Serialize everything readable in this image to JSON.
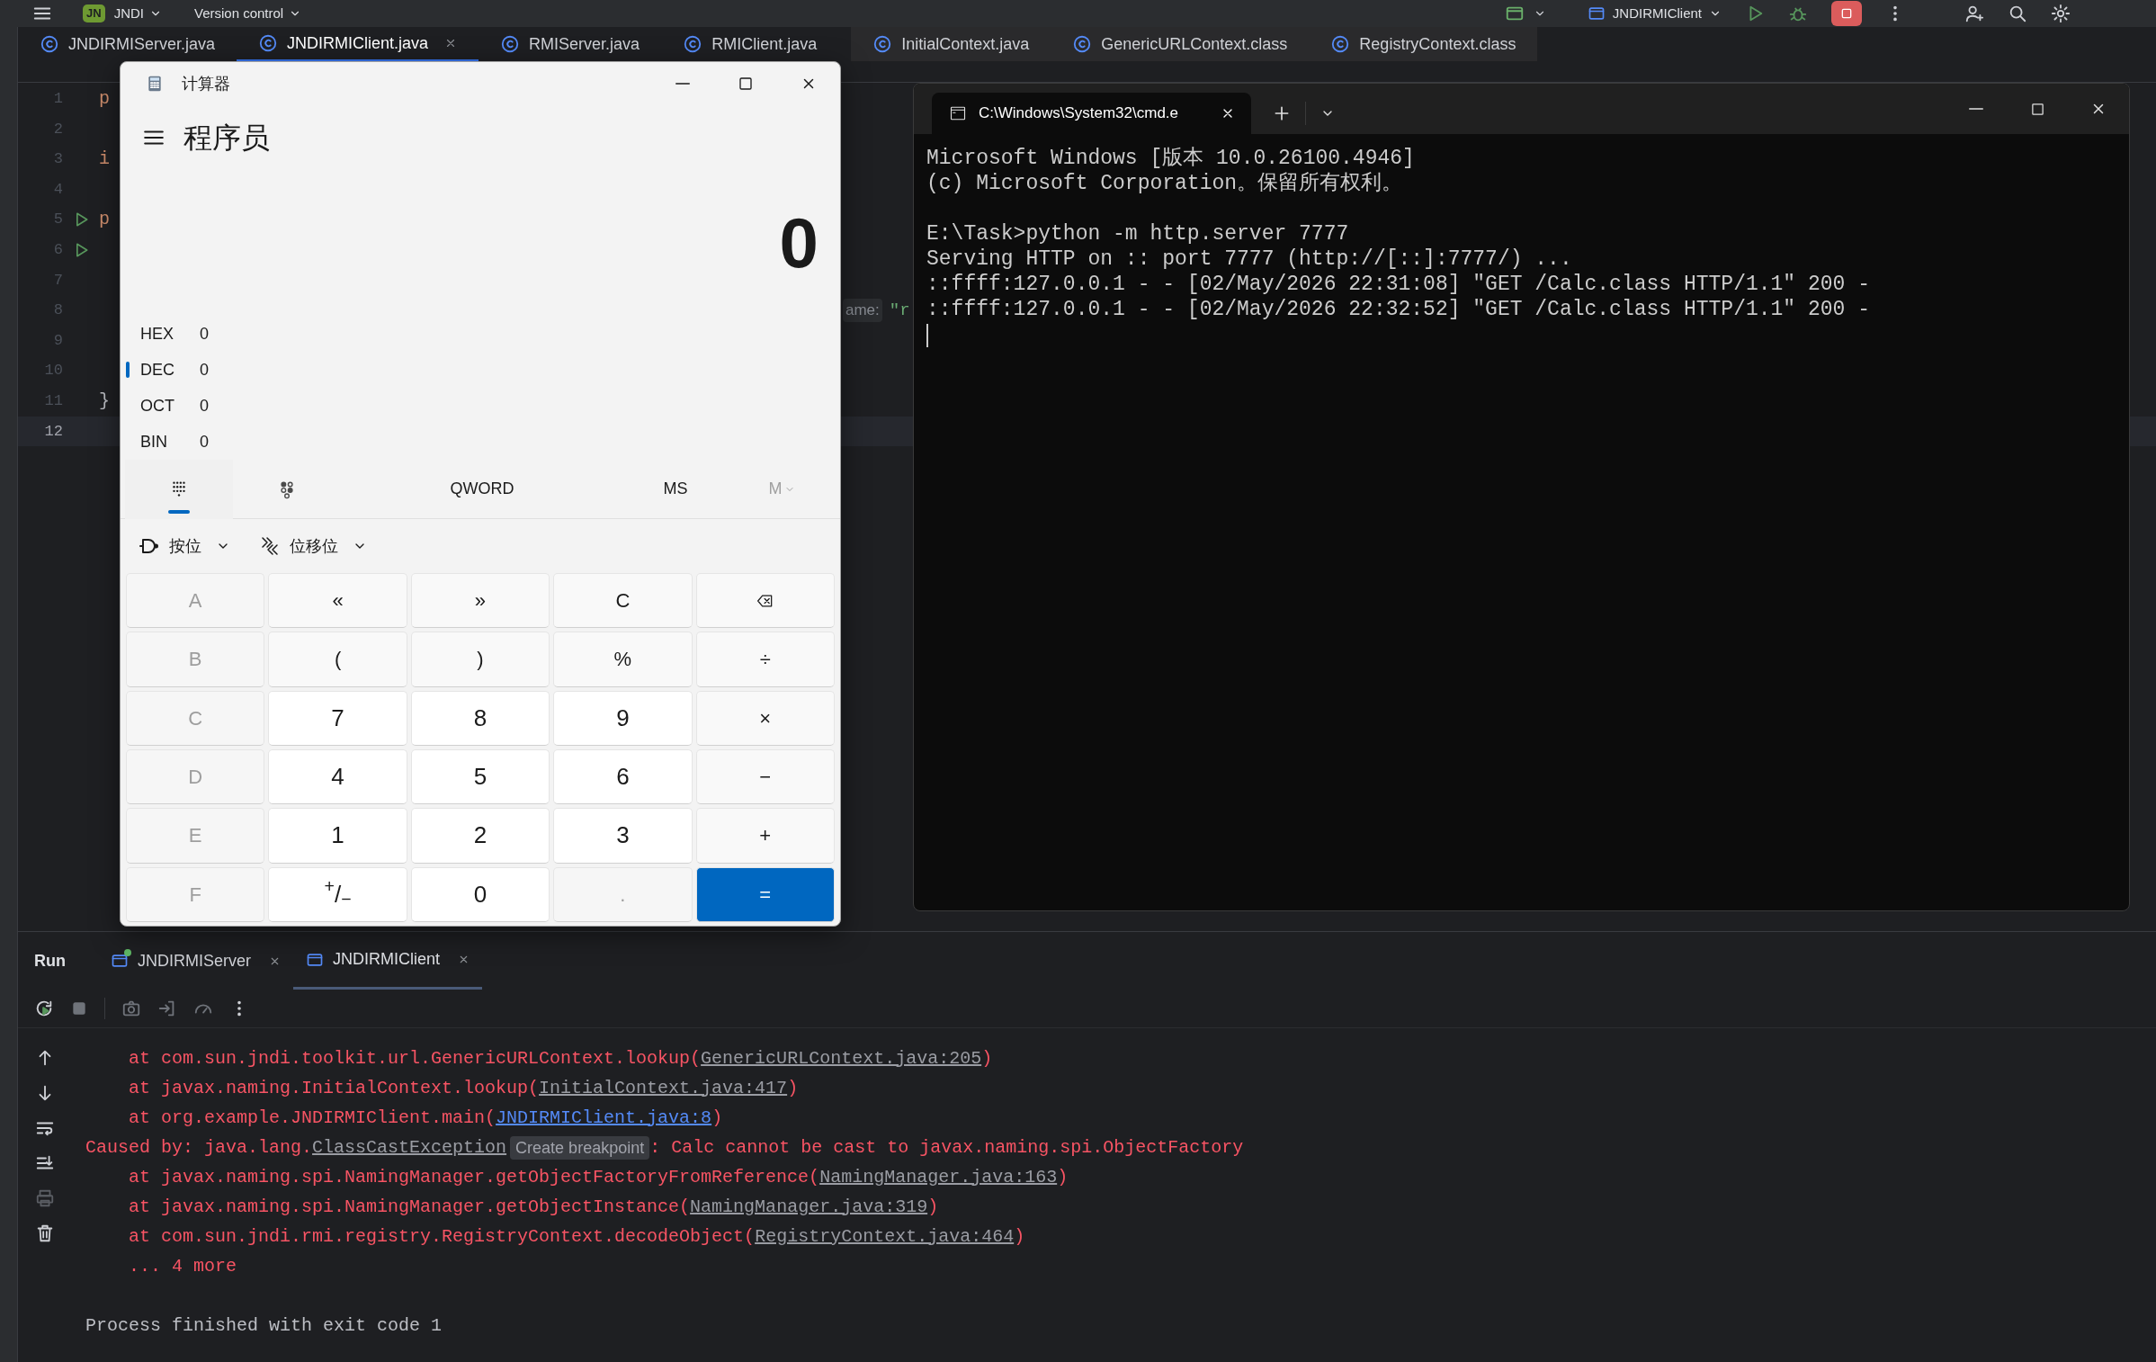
{
  "top_bar": {
    "project_badge": "JN",
    "project": "JNDI",
    "vcs": "Version control",
    "run_config": "JNDIRMIClient"
  },
  "editor_tabs": [
    {
      "label": "JNDIRMIServer.java",
      "selected": false,
      "kind": "project"
    },
    {
      "label": "JNDIRMIClient.java",
      "selected": true,
      "kind": "project"
    },
    {
      "label": "RMIServer.java",
      "selected": false,
      "kind": "project"
    },
    {
      "label": "RMIClient.java",
      "selected": false,
      "kind": "project"
    },
    {
      "label": "InitialContext.java",
      "selected": false,
      "kind": "library"
    },
    {
      "label": "GenericURLContext.class",
      "selected": false,
      "kind": "library"
    },
    {
      "label": "RegistryContext.class",
      "selected": false,
      "kind": "library"
    }
  ],
  "editor": {
    "lines": [
      {
        "number": "1",
        "code": {
          "text": "p",
          "kind": "keyword"
        },
        "runnable": false,
        "current": false
      },
      {
        "number": "2",
        "runnable": false,
        "current": false
      },
      {
        "number": "3",
        "code": {
          "text": "i",
          "kind": "keyword"
        },
        "runnable": false,
        "current": false
      },
      {
        "number": "4",
        "runnable": false,
        "current": false
      },
      {
        "number": "5",
        "code": {
          "text": "p",
          "kind": "keyword"
        },
        "runnable": true,
        "current": false
      },
      {
        "number": "6",
        "runnable": true,
        "current": false
      },
      {
        "number": "7",
        "runnable": false,
        "current": false
      },
      {
        "number": "8",
        "runnable": false,
        "current": false,
        "inlay_hint": "ame:",
        "inlay_value": "\"r"
      },
      {
        "number": "9",
        "runnable": false,
        "current": false
      },
      {
        "number": "10",
        "runnable": false,
        "current": false
      },
      {
        "number": "11",
        "code": {
          "text": "}",
          "kind": "brace"
        },
        "runnable": false,
        "current": false
      },
      {
        "number": "12",
        "runnable": false,
        "current": true
      }
    ]
  },
  "run_panel": {
    "title": "Run",
    "tabs": [
      {
        "label": "JNDIRMIServer",
        "selected": false,
        "running": true
      },
      {
        "label": "JNDIRMIClient",
        "selected": true,
        "running": false
      }
    ],
    "console": [
      {
        "kind": "frame",
        "text": "at com.sun.jndi.toolkit.url.GenericURLContext.lookup(",
        "link": {
          "text": "GenericURLContext.java:205",
          "kind": "library"
        },
        "after": ")"
      },
      {
        "kind": "frame",
        "text": "at javax.naming.InitialContext.lookup(",
        "link": {
          "text": "InitialContext.java:417",
          "kind": "library"
        },
        "after": ")"
      },
      {
        "kind": "frame",
        "text": "at org.example.JNDIRMIClient.main(",
        "link": {
          "text": "JNDIRMIClient.java:8",
          "kind": "project"
        },
        "after": ")"
      },
      {
        "kind": "cause",
        "text": "Caused by: java.lang.",
        "link": {
          "text": "ClassCastException",
          "kind": "library"
        },
        "tooltip": "Create breakpoint",
        "after": ": Calc cannot be cast to javax.naming.spi.ObjectFactory"
      },
      {
        "kind": "frame",
        "text": "at javax.naming.spi.NamingManager.getObjectFactoryFromReference(",
        "link": {
          "text": "NamingManager.java:163",
          "kind": "library"
        },
        "after": ")"
      },
      {
        "kind": "frame",
        "text": "at javax.naming.spi.NamingManager.getObjectInstance(",
        "link": {
          "text": "NamingManager.java:319",
          "kind": "library"
        },
        "after": ")"
      },
      {
        "kind": "frame",
        "text": "at com.sun.jndi.rmi.registry.RegistryContext.decodeObject(",
        "link": {
          "text": "RegistryContext.java:464",
          "kind": "library"
        },
        "after": ")"
      },
      {
        "kind": "frame",
        "text": "... 4 more"
      },
      {
        "kind": "blank"
      },
      {
        "kind": "exit",
        "text": "Process finished with exit code 1"
      }
    ]
  },
  "calculator": {
    "title": "计算器",
    "mode": "程序员",
    "display": "0",
    "radix": [
      {
        "label": "HEX",
        "value": "0",
        "selected": false
      },
      {
        "label": "DEC",
        "value": "0",
        "selected": true
      },
      {
        "label": "OCT",
        "value": "0",
        "selected": false
      },
      {
        "label": "BIN",
        "value": "0",
        "selected": false
      }
    ],
    "view_tabs": [
      {
        "kind": "keypad",
        "selected": true
      },
      {
        "kind": "bits",
        "selected": false
      }
    ],
    "word_size": "QWORD",
    "memory_store": "MS",
    "memory_list": {
      "label": "M",
      "disabled": true
    },
    "bitwise": [
      {
        "label": "按位",
        "kind": "gate"
      },
      {
        "label": "位移位",
        "kind": "shift"
      }
    ],
    "keys": [
      {
        "label": "A",
        "kind": "hex",
        "disabled": true
      },
      {
        "label": "«",
        "kind": "op",
        "disabled": false
      },
      {
        "label": "»",
        "kind": "op",
        "disabled": false
      },
      {
        "label": "C",
        "kind": "op",
        "disabled": false
      },
      {
        "kind": "backspace",
        "disabled": false
      },
      {
        "label": "B",
        "kind": "hex",
        "disabled": true
      },
      {
        "label": "(",
        "kind": "op",
        "disabled": false
      },
      {
        "label": ")",
        "kind": "op",
        "disabled": false
      },
      {
        "label": "%",
        "kind": "op",
        "disabled": false
      },
      {
        "label": "÷",
        "kind": "op",
        "disabled": false
      },
      {
        "label": "C",
        "kind": "hex",
        "disabled": true
      },
      {
        "label": "7",
        "kind": "digit",
        "disabled": false
      },
      {
        "label": "8",
        "kind": "digit",
        "disabled": false
      },
      {
        "label": "9",
        "kind": "digit",
        "disabled": false
      },
      {
        "label": "×",
        "kind": "op",
        "disabled": false
      },
      {
        "label": "D",
        "kind": "hex",
        "disabled": true
      },
      {
        "label": "4",
        "kind": "digit",
        "disabled": false
      },
      {
        "label": "5",
        "kind": "digit",
        "disabled": false
      },
      {
        "label": "6",
        "kind": "digit",
        "disabled": false
      },
      {
        "label": "−",
        "kind": "op",
        "disabled": false
      },
      {
        "label": "E",
        "kind": "hex",
        "disabled": true
      },
      {
        "label": "1",
        "kind": "digit",
        "disabled": false
      },
      {
        "label": "2",
        "kind": "digit",
        "disabled": false
      },
      {
        "label": "3",
        "kind": "digit",
        "disabled": false
      },
      {
        "label": "+",
        "kind": "op",
        "disabled": false
      },
      {
        "label": "F",
        "kind": "hex",
        "disabled": true
      },
      {
        "label": "$^{+}$/$_{−}$",
        "kind": "digit",
        "disabled": false
      },
      {
        "label": "0",
        "kind": "digit",
        "disabled": false
      },
      {
        "label": ".",
        "kind": "digit",
        "disabled": true
      },
      {
        "label": "=",
        "kind": "equals",
        "disabled": false
      }
    ]
  },
  "terminal": {
    "tab_title": "C:\\Windows\\System32\\cmd.e",
    "paragraphs": [
      [
        "Microsoft Windows [版本 10.0.26100.4946]",
        "(c) Microsoft Corporation。保留所有权利。"
      ],
      [
        "E:\\Task>python -m http.server 7777",
        "Serving HTTP on :: port 7777 (http://[::]:7777/) ...",
        "::ffff:127.0.0.1 - - [02/May/2026 22:31:08] \"GET /Calc.class HTTP/1.1\" 200 -",
        "::ffff:127.0.0.1 - - [02/May/2026 22:32:52] \"GET /Calc.class HTTP/1.1\" 200 -"
      ]
    ],
    "cursor": true
  }
}
